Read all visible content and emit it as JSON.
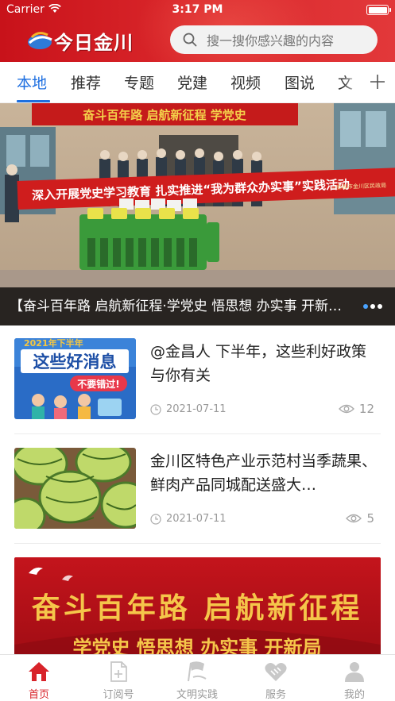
{
  "status_bar": {
    "carrier": "Carrier",
    "time": "3:17 PM"
  },
  "header": {
    "logo_text": "今日金川",
    "search_placeholder": "搜一搜你感兴趣的内容",
    "brand_color": "#d9262a"
  },
  "tabs": {
    "items": [
      {
        "label": "本地",
        "active": true
      },
      {
        "label": "推荐"
      },
      {
        "label": "专题"
      },
      {
        "label": "党建"
      },
      {
        "label": "视频"
      },
      {
        "label": "图说"
      },
      {
        "label": "文"
      }
    ],
    "add_icon": "plus-icon",
    "active_color": "#1e6fe0"
  },
  "banner": {
    "caption": "【奋斗百年路 启航新征程·学党史 悟思想 办实事 开新局】",
    "photo_text": {
      "top_banner": "奋斗百年路 启航新征程 学党史",
      "main_banner": "深入开展党史学习教育 扎实推进“我为群众办实事”实践活动",
      "sub_banner": "—金昌市金川区民政局"
    },
    "slides_total": 3,
    "slide_active": 1
  },
  "news": [
    {
      "title": "@金昌人 下半年，这些利好政策与你有关",
      "date": "2021-07-11",
      "views": "12",
      "thumb_text": {
        "year": "2021年下半年",
        "headline": "这些好消息",
        "sub": "不要错过!"
      }
    },
    {
      "title": "金川区特色产业示范村当季蔬果、鲜肉产品同城配送盛大…",
      "date": "2021-07-11",
      "views": "5"
    }
  ],
  "feature_card": {
    "line1": "奋斗百年路 启航新征程",
    "line2": "学党史 悟思想 办实事 开新局"
  },
  "bottom_nav": [
    {
      "label": "首页",
      "icon": "home-icon",
      "active": true
    },
    {
      "label": "订阅号",
      "icon": "subscribe-icon"
    },
    {
      "label": "文明实践",
      "icon": "flag-icon"
    },
    {
      "label": "服务",
      "icon": "handshake-icon"
    },
    {
      "label": "我的",
      "icon": "user-icon"
    }
  ]
}
